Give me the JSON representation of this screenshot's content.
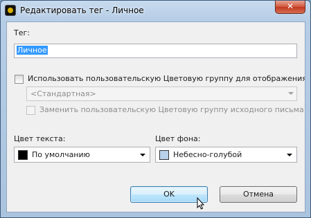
{
  "window": {
    "title": "Редактировать тег - Личное",
    "close_symbol": "✕"
  },
  "form": {
    "tag_label": "Тег:",
    "tag_value": "Личное",
    "use_color_checkbox": {
      "label": "Использовать пользовательскую Цветовую группу для отображения пис",
      "checked": false
    },
    "color_group_select": {
      "value": "<Стандартная>",
      "enabled": false
    },
    "replace_checkbox": {
      "label": "Заменить пользовательскую Цветовую группу исходного письма",
      "checked": false,
      "enabled": false
    },
    "text_color": {
      "label": "Цвет текста:",
      "value": "По умолчанию",
      "swatch": "#000000"
    },
    "bg_color": {
      "label": "Цвет фона:",
      "value": "Небесно-голубой",
      "swatch": "#b9d1ea"
    }
  },
  "buttons": {
    "ok": "OK",
    "cancel": "Отмена"
  }
}
